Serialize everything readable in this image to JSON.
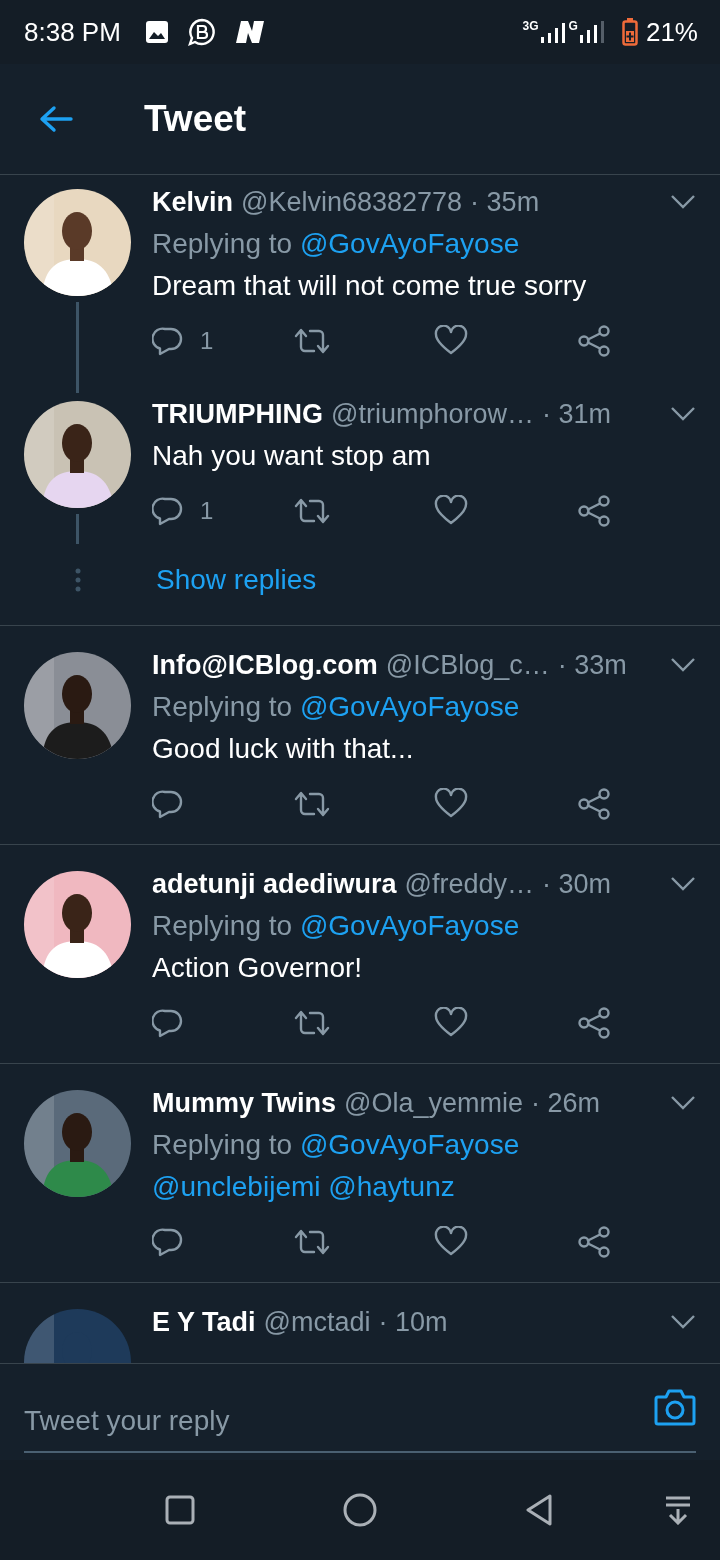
{
  "status_bar": {
    "time": "8:38 PM",
    "network_1": "3G",
    "network_2": "G",
    "battery": "21%"
  },
  "header": {
    "title": "Tweet"
  },
  "conversations": [
    {
      "tweets": [
        {
          "name": "Kelvin",
          "handle": "@Kelvin68382778",
          "time": "· 35m",
          "replying_label": "Replying to",
          "replying_to": "@GovAyoFayose",
          "text": "Dream that will not come true sorry",
          "text_link": false,
          "reply_count": "1"
        },
        {
          "name": "TRIUMPHING",
          "handle": "@triumphorow…",
          "time": "· 31m",
          "text": "Nah you want stop am",
          "text_link": false,
          "reply_count": "1"
        }
      ],
      "show_replies": "Show replies"
    },
    {
      "tweets": [
        {
          "name": "Info@ICBlog.com",
          "handle": "@ICBlog_c…",
          "time": "· 33m",
          "replying_label": "Replying to",
          "replying_to": "@GovAyoFayose",
          "text": "Good luck with that...",
          "text_link": false
        }
      ]
    },
    {
      "tweets": [
        {
          "name": "adetunji adediwura",
          "handle": "@freddy…",
          "time": "· 30m",
          "replying_label": "Replying to",
          "replying_to": "@GovAyoFayose",
          "text": "Action Governor!",
          "text_link": false
        }
      ]
    },
    {
      "tweets": [
        {
          "name": "Mummy Twins",
          "handle": "@Ola_yemmie",
          "time": "· 26m",
          "replying_label": "Replying to",
          "replying_to": "@GovAyoFayose",
          "text": "@unclebijemi @haytunz",
          "text_link": true
        }
      ]
    },
    {
      "tweets": [
        {
          "name": "E Y Tadi",
          "handle": "@mctadi",
          "time": "· 10m"
        }
      ]
    }
  ],
  "reply_bar": {
    "placeholder": "Tweet your reply"
  }
}
